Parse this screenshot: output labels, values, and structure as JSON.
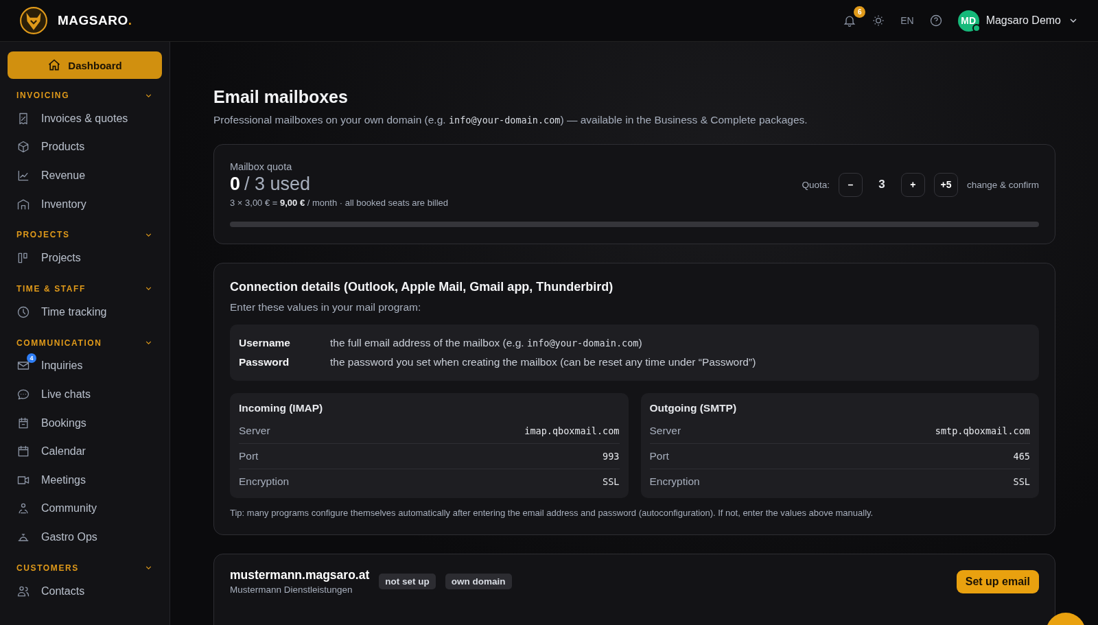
{
  "brand": {
    "name": "MAGSARO",
    "dot": "."
  },
  "topbar": {
    "notifications": "6",
    "language": "EN",
    "user": {
      "initials": "MD",
      "name": "Magsaro Demo",
      "online": true
    }
  },
  "sidebar": {
    "dashboard": {
      "label": "Dashboard",
      "selected": true
    },
    "sections": [
      {
        "title": "INVOICING",
        "expanded": true,
        "items": [
          {
            "label": "Invoices & quotes"
          },
          {
            "label": "Products"
          },
          {
            "label": "Revenue"
          },
          {
            "label": "Inventory"
          }
        ]
      },
      {
        "title": "PROJECTS",
        "expanded": true,
        "items": [
          {
            "label": "Projects"
          }
        ]
      },
      {
        "title": "TIME & STAFF",
        "expanded": true,
        "items": [
          {
            "label": "Time tracking"
          }
        ]
      },
      {
        "title": "COMMUNICATION",
        "expanded": true,
        "items": [
          {
            "label": "Inquiries",
            "badge": "4"
          },
          {
            "label": "Live chats"
          },
          {
            "label": "Bookings"
          },
          {
            "label": "Calendar"
          },
          {
            "label": "Meetings"
          },
          {
            "label": "Community"
          },
          {
            "label": "Gastro Ops"
          }
        ]
      },
      {
        "title": "CUSTOMERS",
        "expanded": true,
        "items": [
          {
            "label": "Contacts"
          }
        ]
      }
    ]
  },
  "page": {
    "title": "Email mailboxes",
    "subtitle_before": "Professional mailboxes on your own domain (e.g. ",
    "subtitle_code": "info@your-domain.com",
    "subtitle_after": ") — available in the Business & Complete packages."
  },
  "quota": {
    "label": "Mailbox quota",
    "used": "0",
    "total": "/ 3 used",
    "price": "3 × 3,00 € = **9,00 €** / month · all booked seats are billed",
    "quota_label": "Quota:",
    "minus": "–",
    "value": "3",
    "plus": "+",
    "plus5": "+5",
    "hint": "change & confirm"
  },
  "connection": {
    "title": "Connection details (Outlook, Apple Mail, Gmail app, Thunderbird)",
    "subtitle": "Enter these values in your mail program:",
    "credentials": [
      {
        "key": "Username",
        "before": "the full email address of the mailbox (e.g. ",
        "code": "info@your-domain.com",
        "after": ")"
      },
      {
        "key": "Password",
        "before": "the password you set when creating the mailbox (can be reset any time under “Password”)"
      }
    ],
    "servers": [
      {
        "title": "Incoming (IMAP)",
        "rows": [
          {
            "key": "Server",
            "value": "imap.qboxmail.com"
          },
          {
            "key": "Port",
            "value": "993"
          },
          {
            "key": "Encryption",
            "value": "SSL"
          }
        ]
      },
      {
        "title": "Outgoing (SMTP)",
        "rows": [
          {
            "key": "Server",
            "value": "smtp.qboxmail.com"
          },
          {
            "key": "Port",
            "value": "465"
          },
          {
            "key": "Encryption",
            "value": "SSL"
          }
        ]
      }
    ],
    "tip": "Tip: many programs configure themselves automatically after entering the email address and password (autoconfiguration). If not, enter the values above manually."
  },
  "domain": {
    "name": "mustermann.magsaro.at",
    "company": "Mustermann Dienstleistungen",
    "tags": [
      "not set up",
      "own domain"
    ],
    "action": "Set up email"
  }
}
